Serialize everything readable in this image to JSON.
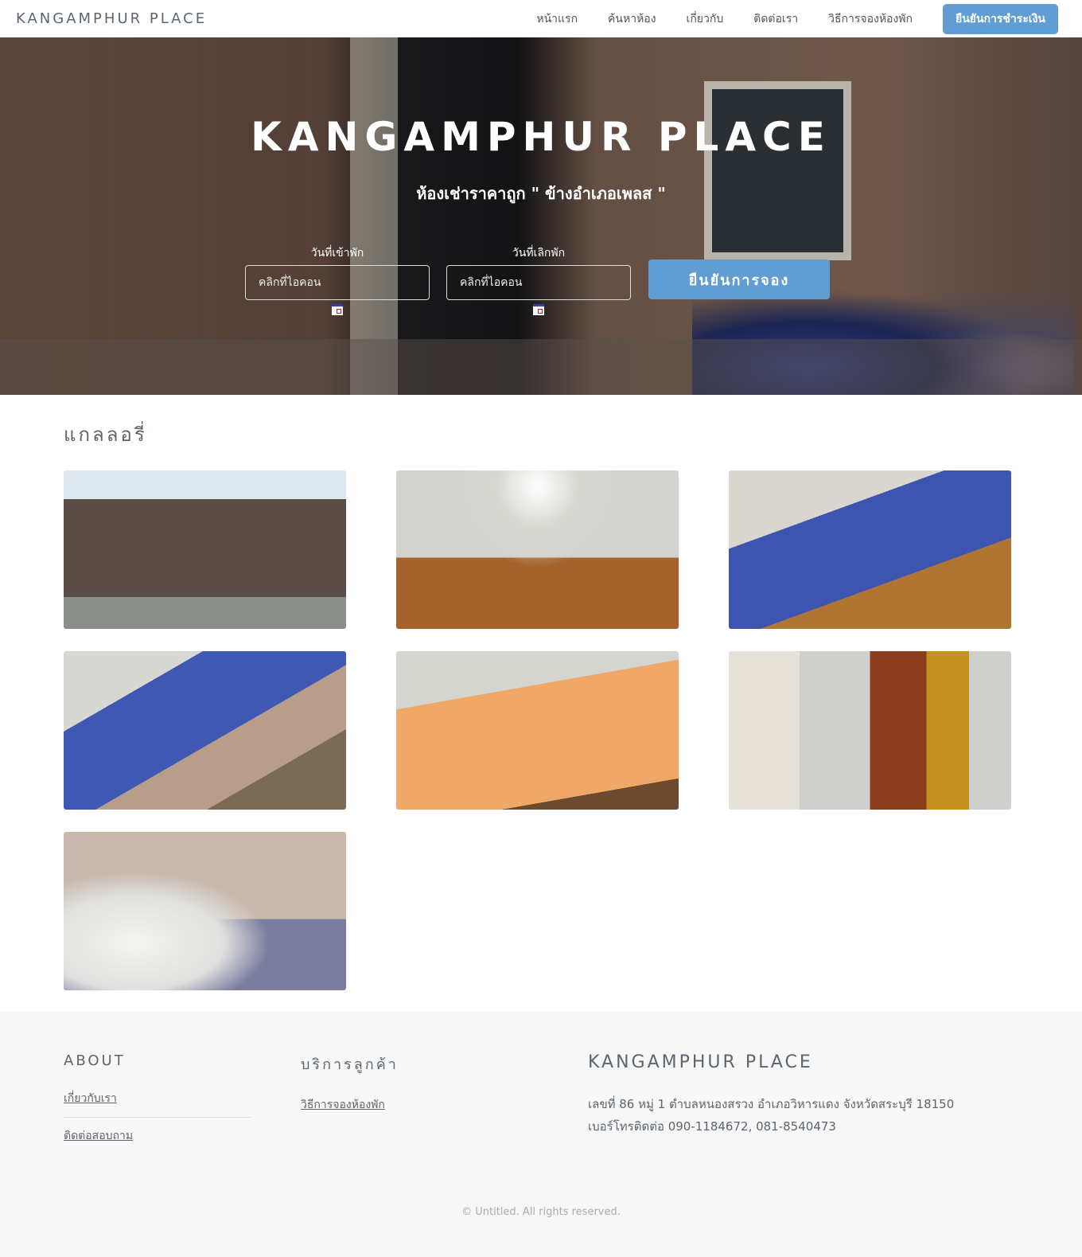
{
  "nav": {
    "brand": "KANGAMPHUR PLACE",
    "items": [
      "หน้าแรก",
      "ค้นหาห้อง",
      "เกี่ยวกับ",
      "ติดต่อเรา",
      "วิธีการจองห้องพัก"
    ],
    "pay_button": "ยืนยันการชำระเงิน"
  },
  "hero": {
    "title": "KANGAMPHUR PLACE",
    "subtitle": "ห้องเช่าราคาถูก \" ข้างอำเภอเพลส \"",
    "checkin": {
      "label": "วันที่เข้าพัก",
      "placeholder": "คลิกที่ไอคอน",
      "icon": "calendar-icon"
    },
    "checkout": {
      "label": "วันที่เลิกพัก",
      "placeholder": "คลิกที่ไอคอน",
      "icon": "calendar-icon"
    },
    "book_button": "ยืนยันการจอง"
  },
  "gallery": {
    "title": "แกลลอรี่",
    "count": 7
  },
  "footer": {
    "about": {
      "title": "ABOUT",
      "links": [
        "เกี่ยวกับเรา",
        "ติดต่อสอบถาม"
      ]
    },
    "service": {
      "title": "บริการลูกค้า",
      "links": [
        "วิธีการจองห้องพัก"
      ]
    },
    "contact": {
      "title": "KANGAMPHUR PLACE",
      "address": "เลขที่ 86 หมู่ 1 ตำบลหนองสรวง อำเภอวิหารแดง จังหวัดสระบุรี 18150",
      "phone": "เบอร์โทรติดต่อ 090-1184672, 081-8540473"
    },
    "copyright": "© Untitled. All rights reserved."
  },
  "colors": {
    "accent": "#5f9dd3",
    "footer_bg": "#f7f7f7"
  }
}
